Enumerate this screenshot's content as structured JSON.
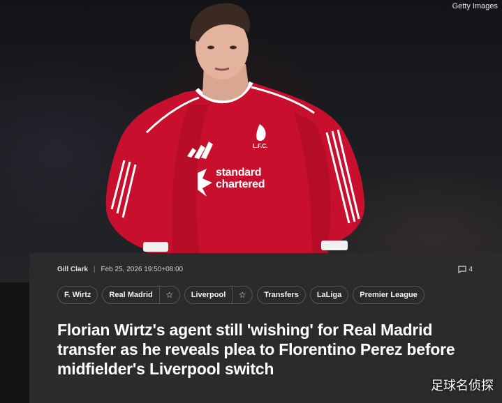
{
  "hero": {
    "credit": "Getty Images",
    "shirt_sponsor": "standard chartered",
    "crest_text": "L.F.C."
  },
  "article": {
    "author": "Gill Clark",
    "separator": "|",
    "timestamp": "Feb 25, 2026 19:50+08:00",
    "comment_count": "4",
    "tags": [
      {
        "label": "F. Wirtz"
      },
      {
        "label": "Real Madrid"
      },
      {
        "label": "Liverpool"
      },
      {
        "label": "Transfers"
      },
      {
        "label": "LaLiga"
      },
      {
        "label": "Premier League"
      }
    ],
    "headline": "Florian Wirtz's agent still 'wishing' for Real Madrid transfer as he reveals plea to Florentino Perez before midfielder's Liverpool switch"
  },
  "watermark": "足球名侦探",
  "colors": {
    "shirt_red": "#c8102e",
    "card_bg": "#2b2b2b",
    "chip_border": "#555555"
  }
}
